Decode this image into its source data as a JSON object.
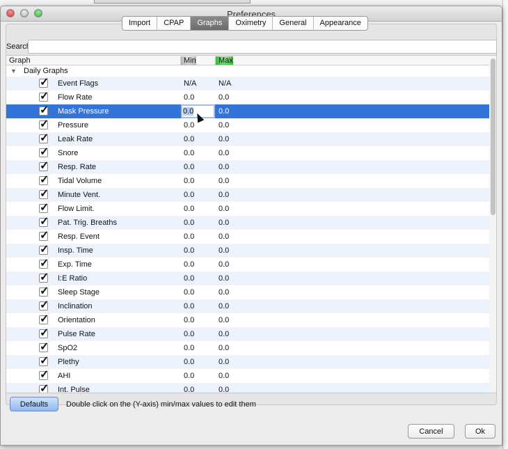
{
  "window": {
    "title": "Preferences"
  },
  "tabs": [
    "Import",
    "CPAP",
    "Graphs",
    "Oximetry",
    "General",
    "Appearance"
  ],
  "active_tab": "Graphs",
  "search": {
    "label": "Search",
    "value": ""
  },
  "table": {
    "columns": [
      "Graph",
      "Min",
      "Max"
    ],
    "group": "Daily Graphs",
    "rows": [
      {
        "name": "Event Flags",
        "min": "N/A",
        "max": "N/A",
        "checked": true
      },
      {
        "name": "Flow Rate",
        "min": "0.0",
        "max": "0.0",
        "checked": true
      },
      {
        "name": "Mask Pressure",
        "min": "0.0",
        "max": "0.0",
        "checked": true,
        "selected": true,
        "editing": true
      },
      {
        "name": "Pressure",
        "min": "0.0",
        "max": "0.0",
        "checked": true
      },
      {
        "name": "Leak Rate",
        "min": "0.0",
        "max": "0.0",
        "checked": true
      },
      {
        "name": "Snore",
        "min": "0.0",
        "max": "0.0",
        "checked": true
      },
      {
        "name": "Resp. Rate",
        "min": "0.0",
        "max": "0.0",
        "checked": true
      },
      {
        "name": "Tidal Volume",
        "min": "0.0",
        "max": "0.0",
        "checked": true
      },
      {
        "name": "Minute Vent.",
        "min": "0.0",
        "max": "0.0",
        "checked": true
      },
      {
        "name": "Flow Limit.",
        "min": "0.0",
        "max": "0.0",
        "checked": true
      },
      {
        "name": "Pat. Trig. Breaths",
        "min": "0.0",
        "max": "0.0",
        "checked": true
      },
      {
        "name": "Resp. Event",
        "min": "0.0",
        "max": "0.0",
        "checked": true
      },
      {
        "name": "Insp. Time",
        "min": "0.0",
        "max": "0.0",
        "checked": true
      },
      {
        "name": "Exp. Time",
        "min": "0.0",
        "max": "0.0",
        "checked": true
      },
      {
        "name": "I:E Ratio",
        "min": "0.0",
        "max": "0.0",
        "checked": true
      },
      {
        "name": "Sleep Stage",
        "min": "0.0",
        "max": "0.0",
        "checked": true
      },
      {
        "name": "Inclination",
        "min": "0.0",
        "max": "0.0",
        "checked": true
      },
      {
        "name": "Orientation",
        "min": "0.0",
        "max": "0.0",
        "checked": true
      },
      {
        "name": "Pulse Rate",
        "min": "0.0",
        "max": "0.0",
        "checked": true
      },
      {
        "name": "SpO2",
        "min": "0.0",
        "max": "0.0",
        "checked": true
      },
      {
        "name": "Plethy",
        "min": "0.0",
        "max": "0.0",
        "checked": true
      },
      {
        "name": "AHI",
        "min": "0.0",
        "max": "0.0",
        "checked": true
      },
      {
        "name": "Int. Pulse",
        "min": "0.0",
        "max": "0.0",
        "checked": true
      }
    ]
  },
  "footer": {
    "defaults_label": "Defaults",
    "hint": "Double click on the (Y-axis) min/max values to edit them",
    "cancel_label": "Cancel",
    "ok_label": "Ok"
  },
  "colors": {
    "selection": "#3474d8",
    "alt_row": "#edf3fc"
  }
}
